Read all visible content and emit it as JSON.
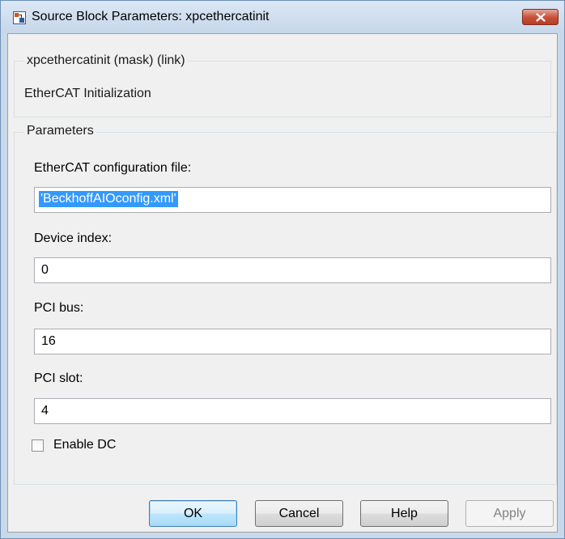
{
  "window": {
    "title": "Source Block Parameters: xpcethercatinit",
    "close_label": "close"
  },
  "mask_group": {
    "legend": "xpcethercatinit (mask) (link)",
    "description": "EtherCAT Initialization"
  },
  "params_group": {
    "legend": "Parameters",
    "fields": [
      {
        "label": "EtherCAT configuration file:",
        "value": "'BeckhoffAIOconfig.xml'",
        "selected": true
      },
      {
        "label": "Device index:",
        "value": "0",
        "selected": false
      },
      {
        "label": "PCI bus:",
        "value": "16",
        "selected": false
      },
      {
        "label": "PCI slot:",
        "value": "4",
        "selected": false
      }
    ],
    "checkbox": {
      "label": "Enable DC",
      "checked": false
    }
  },
  "buttons": {
    "ok": "OK",
    "cancel": "Cancel",
    "help": "Help",
    "apply": "Apply"
  },
  "colors": {
    "selection": "#3399ff",
    "close_button": "#c9543b"
  },
  "icons": {
    "app": "simulink-block-icon",
    "close": "close-icon"
  }
}
